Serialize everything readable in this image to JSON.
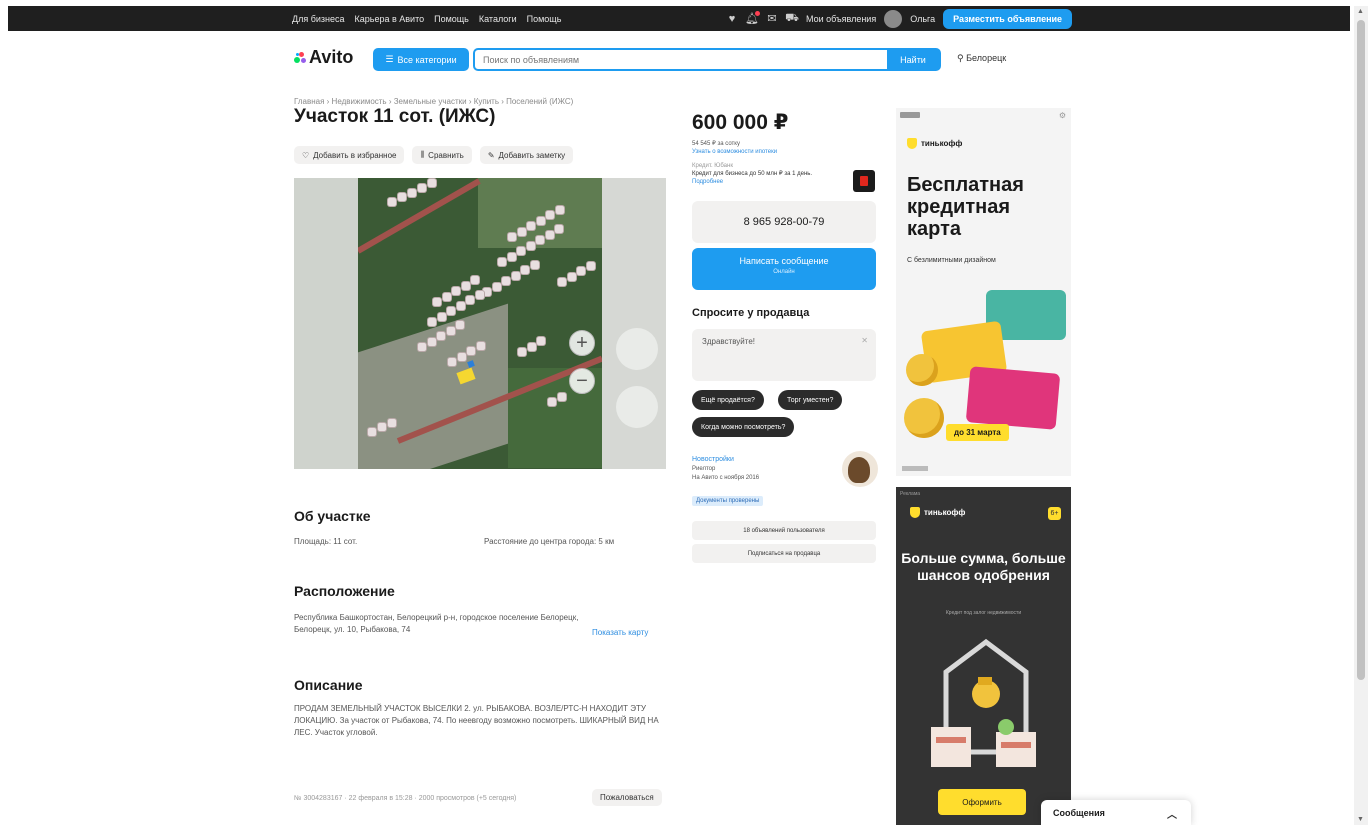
{
  "topbar": {
    "nav": [
      "Для бизнеса",
      "Карьера в Авито",
      "Помощь",
      "Каталоги",
      "Помощь"
    ],
    "my_ads": "Мои объявления",
    "user": "Ольга",
    "post_button": "Разместить объявление"
  },
  "header": {
    "logo": "Avito",
    "categories_button": "Все категории",
    "search_placeholder": "Поиск по объявлениям",
    "search_button": "Найти",
    "region": "Белорецк"
  },
  "breadcrumbs": "Главная › Недвижимость › Земельные участки › Купить › Поселений (ИЖС)",
  "title": "Участок 11 сот. (ИЖС)",
  "actions": {
    "favorite": "Добавить в избранное",
    "compare": "Сравнить",
    "note": "Добавить заметку"
  },
  "about": {
    "heading": "Об участке",
    "area": "Площадь: 11 сот.",
    "distance": "Расстояние до центра города: 5 км"
  },
  "location": {
    "heading": "Расположение",
    "address": "Республика Башкортостан, Белорецкий р-н, городское поселение Белорецк, Белорецк, ул. 10, Рыбакова, 74",
    "show_map": "Показать карту"
  },
  "description": {
    "heading": "Описание",
    "text": "ПРОДАМ ЗЕМЕЛЬНЫЙ УЧАСТОК ВЫСЕЛКИ 2. ул. РЫБАКОВА. ВОЗЛЕ/РТС-Н НАХОДИТ ЭТУ ЛОКАЦИЮ. За участок от Рыбакова, 74. По неевгоду возможно посмотреть. ШИКАРНЫЙ ВИД НА ЛЕС. Участок угловой."
  },
  "footer": {
    "meta": "№ 3004283167 · 22 февраля в 15:28 · 2000 просмотров (+5 сегодня)",
    "complain": "Пожаловаться"
  },
  "seller_block": {
    "price": "600 000 ₽",
    "price_per": "54 545 ₽ за сотку",
    "price_link": "Узнать о возможности ипотеки",
    "credit_label": "Кредит. Юбанк",
    "credit_text": "Кредит для бизнеса до 50 млн ₽ за 1 день.",
    "credit_more": "Подробнее",
    "phone": "8 965 928-00-79",
    "message_button": "Написать сообщение",
    "message_sub": "Онлайн",
    "ask_title": "Спросите у продавца",
    "ask_text": "Здравствуйте!",
    "chips": [
      "Ещё продаётся?",
      "Торг уместен?",
      "Когда можно посмотреть?"
    ],
    "seller_name": "Новостройки",
    "seller_role": "Риелтор",
    "seller_since": "На Авито с ноября 2016",
    "docs_badge": "Документы проверены",
    "more_ads": "18 объявлений пользователя",
    "subscribe": "Подписаться на продавца"
  },
  "ad_top": {
    "brand": "тинькофф",
    "headline": "Бесплатная кредитная карта",
    "sub": "С безлимитными дизайном",
    "date_badge": "до 31 марта"
  },
  "ad_bottom": {
    "tag": "Реклама",
    "brand": "тинькофф",
    "badge": "6+",
    "headline": "Больше сумма, больше шансов одобрения",
    "sub": "Кредит под залог недвижимости",
    "button": "Оформить"
  },
  "messages_widget": "Сообщения",
  "colors": {
    "accent": "#1e9cf0",
    "tinkoff_yellow": "#ffdd2d",
    "topbar": "#1f1f1f"
  }
}
